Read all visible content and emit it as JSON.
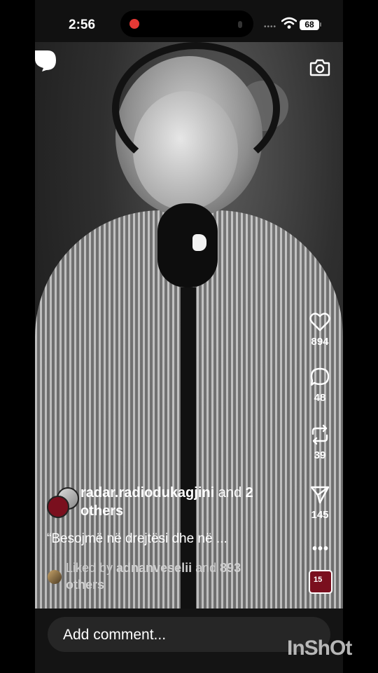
{
  "status_bar": {
    "time": "2:56",
    "battery": "68"
  },
  "post": {
    "author_name": "radar.radiodukagjini",
    "author_suffix_1": " and ",
    "author_suffix_2": "2",
    "author_line2": "others",
    "caption": "“Besojmë në drejtësi dhe në ...",
    "liked_prefix": "Liked by ",
    "liked_user": "adnanveselii",
    "liked_middle": " and ",
    "liked_count": "893",
    "liked_suffix": "others"
  },
  "actions": {
    "likes": "894",
    "comments": "48",
    "reposts": "39",
    "shares": "145"
  },
  "badge": {
    "text": "15"
  },
  "comment": {
    "placeholder": "Add comment..."
  },
  "watermark": "InShOt"
}
